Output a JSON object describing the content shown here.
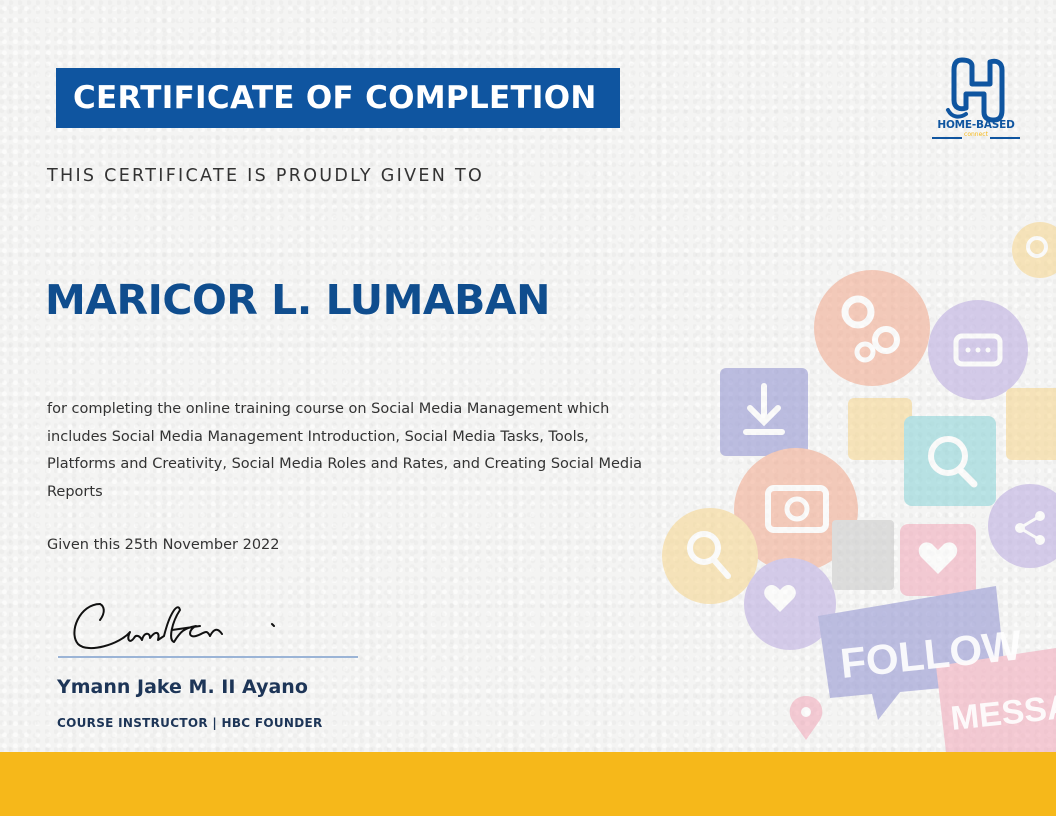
{
  "certificate": {
    "title": "CERTIFICATE OF COMPLETION",
    "given_to_label": "THIS CERTIFICATE IS PROUDLY GIVEN TO",
    "recipient": "MARICOR L. LUMABAN",
    "description": "for completing the online training course on Social Media Management which includes Social Media Management Introduction, Social Media Tasks, Tools, Platforms and Creativity, Social Media Roles and Rates, and Creating Social Media Reports",
    "date_line": "Given this 25th November 2022",
    "instructor_name": "Ymann Jake M. II Ayano",
    "instructor_role": "COURSE INSTRUCTOR | HBC FOUNDER"
  },
  "logo": {
    "name": "HOME-BASED",
    "sub": "connect"
  },
  "collage": {
    "follow_text": "FOLLOW",
    "message_text": "MESSAG"
  },
  "colors": {
    "primary_blue": "#0f55a0",
    "recipient_blue": "#0f4d8e",
    "accent_yellow": "#f6b81a",
    "navy_text": "#1d3557"
  }
}
